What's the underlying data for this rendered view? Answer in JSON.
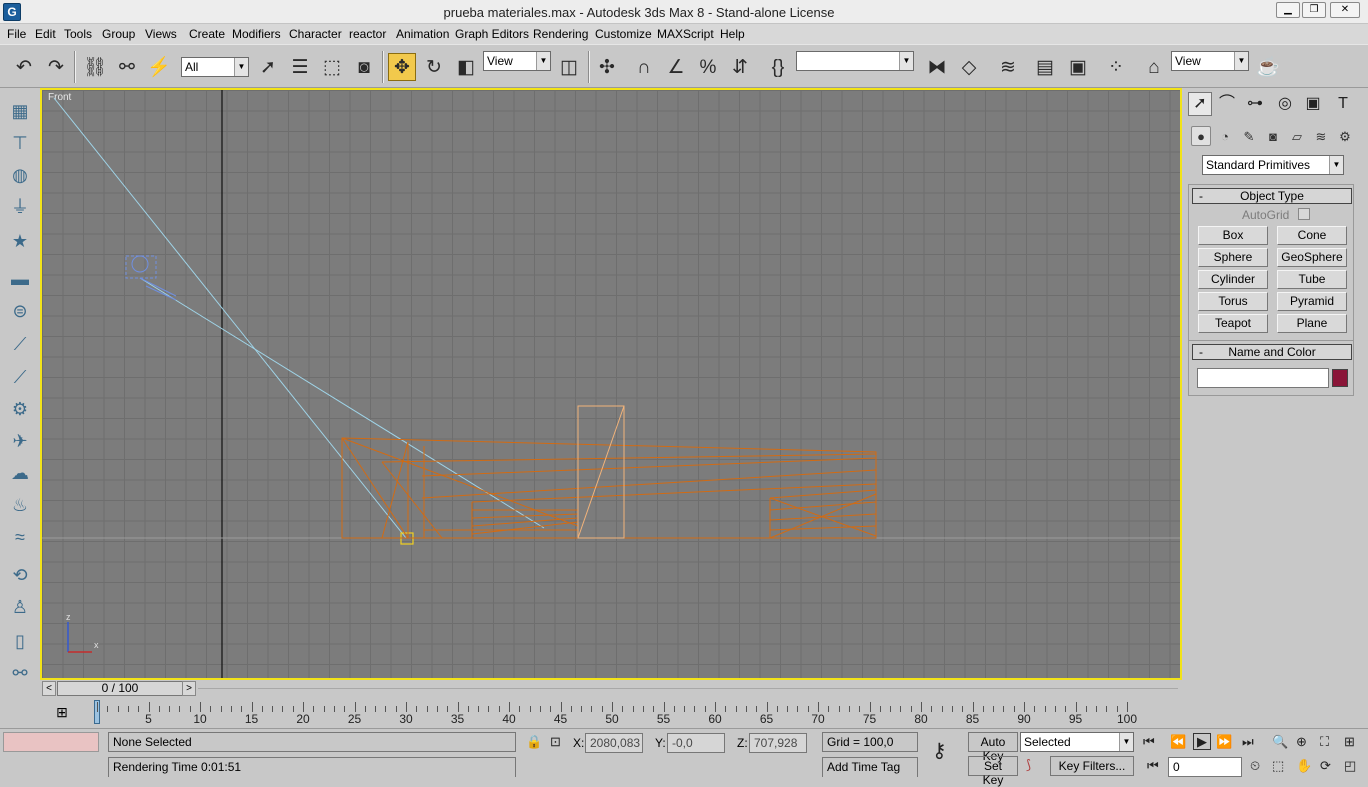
{
  "window": {
    "title": "prueba materiales.max - Autodesk 3ds Max 8 - Stand-alone License",
    "app_icon_letter": "G",
    "minimize": "▁",
    "restore": "❐",
    "close": "✕"
  },
  "menu": [
    "File",
    "Edit",
    "Tools",
    "Group",
    "Views",
    "Create",
    "Modifiers",
    "Character",
    "reactor",
    "Animation",
    "Graph Editors",
    "Rendering",
    "Customize",
    "MAXScript",
    "Help"
  ],
  "toolbar": {
    "selection_filter": "All",
    "ref_coord": "View",
    "named_selection": "",
    "view_dropdown": "View"
  },
  "viewport": {
    "label": "Front",
    "axis_x": "x",
    "axis_z": "z"
  },
  "command_panel": {
    "category_dropdown": "Standard Primitives",
    "object_type_title": "Object Type",
    "autogrid_label": "AutoGrid",
    "buttons": [
      "Box",
      "Cone",
      "Sphere",
      "GeoSphere",
      "Cylinder",
      "Tube",
      "Torus",
      "Pyramid",
      "Teapot",
      "Plane"
    ],
    "name_color_title": "Name and Color",
    "name_value": "",
    "color": "#8a1538",
    "collapse_symbol": "-"
  },
  "timeline": {
    "frame_display": "0 / 100",
    "prev": "<",
    "next": ">",
    "ticks": [
      "5",
      "10",
      "15",
      "20",
      "25",
      "30",
      "35",
      "40",
      "45",
      "50",
      "55",
      "60",
      "65",
      "70",
      "75",
      "80",
      "85",
      "90",
      "95",
      "100"
    ]
  },
  "status": {
    "selection": "None Selected",
    "prompt": "Rendering Time  0:01:51",
    "x_label": "X:",
    "x_value": "2080,083",
    "y_label": "Y:",
    "y_value": "-0,0",
    "z_label": "Z:",
    "z_value": "707,928",
    "grid": "Grid = 100,0",
    "add_time_tag": "Add Time Tag",
    "auto_key": "Auto Key",
    "set_key": "Set Key",
    "key_mode": "Selected",
    "key_filters": "Key Filters...",
    "current_frame": "0"
  }
}
